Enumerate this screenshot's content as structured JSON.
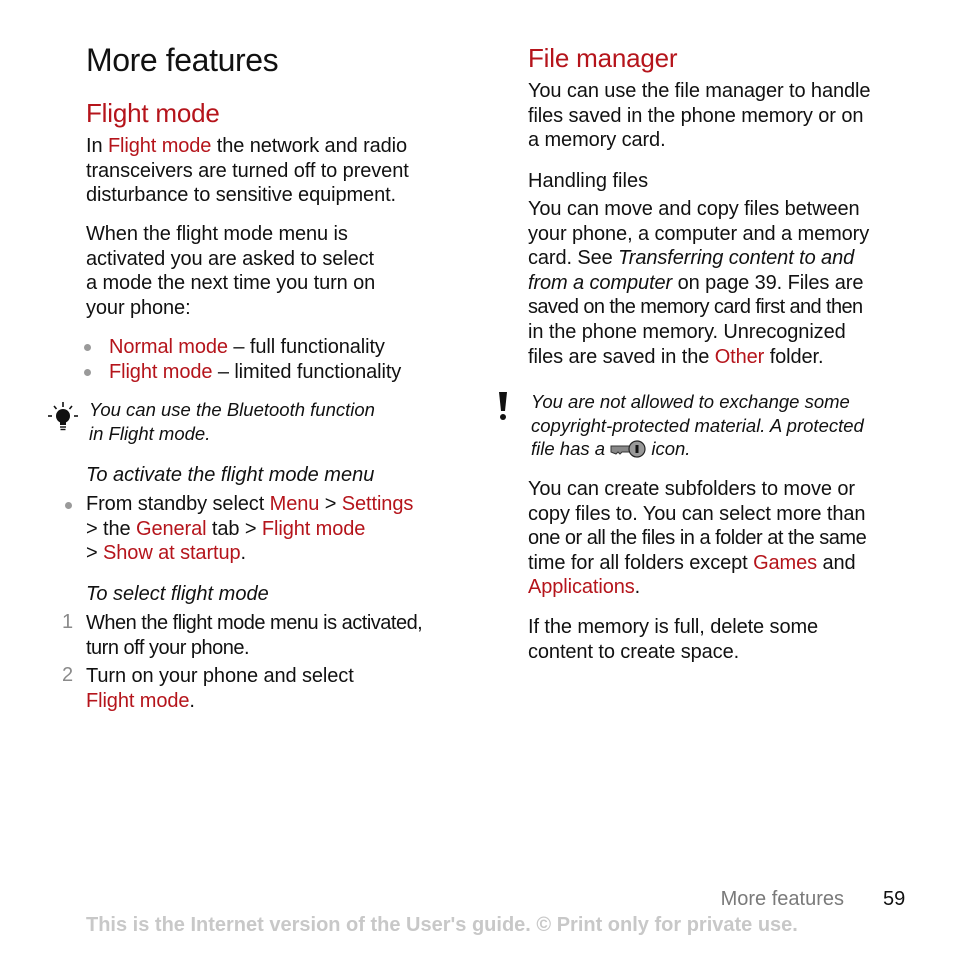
{
  "page": {
    "title": "More features",
    "left": {
      "flight_mode": {
        "heading": "Flight mode",
        "intro": [
          "In ",
          "Flight mode",
          " the network and radio",
          "transceivers are turned off to prevent",
          "disturbance to sensitive equipment."
        ],
        "para2": [
          "When the flight mode menu is",
          "activated you are asked to select",
          "a mode the next time you turn on",
          "your phone:"
        ],
        "bullets": [
          {
            "link": "Normal mode",
            "text": " – full functionality"
          },
          {
            "link": "Flight mode",
            "text": " – limited functionality"
          }
        ],
        "tip": {
          "icon": "lightbulb-icon",
          "lines": [
            "You can use the Bluetooth function",
            "in Flight mode."
          ]
        },
        "activate": {
          "title": "To activate the flight mode menu",
          "step": {
            "parts": [
              "From standby select ",
              "Menu",
              " > ",
              "Settings"
            ],
            "line2": [
              "> the ",
              "General",
              " tab > ",
              "Flight mode"
            ],
            "line3": [
              "> ",
              "Show at startup",
              "."
            ]
          }
        },
        "select": {
          "title": "To select flight mode",
          "steps": [
            {
              "num": "1",
              "lines": [
                "When the flight mode menu is activated,",
                "turn off your phone."
              ]
            },
            {
              "num": "2",
              "line1": "Turn on your phone and select",
              "link": "Flight mode",
              "after": "."
            }
          ]
        }
      }
    },
    "right": {
      "file_manager": {
        "heading": "File manager",
        "intro": [
          "You can use the file manager to handle",
          "files saved in the phone memory or on",
          "a memory card."
        ],
        "handling": {
          "title": "Handling files",
          "lines": [
            "You can move and copy files between",
            "your phone, a computer and a memory",
            [
              "card. See ",
              "Transferring content to and"
            ],
            [
              "from a computer",
              " on page 39. Files are"
            ],
            "saved on the memory card first and then",
            "in the phone memory. Unrecognized",
            [
              "files are saved in the ",
              "Other",
              " folder."
            ]
          ]
        },
        "warning": {
          "icon": "exclamation-icon",
          "lines": [
            "You are not allowed to exchange some",
            "copyright-protected material. A protected"
          ],
          "line3_before": "file has a ",
          "inline_icon": "key-icon",
          "line3_after": " icon."
        },
        "subfolders": [
          "You can create subfolders to move or",
          "copy files to. You can select more than",
          "one or all the files in a folder at the same",
          [
            "time for all folders except ",
            "Games",
            " and"
          ],
          [
            "Applications",
            "."
          ]
        ],
        "memory_full": [
          "If the memory is full, delete some",
          "content to create space."
        ]
      }
    },
    "footer": {
      "section": "More features",
      "page_number": "59",
      "disclaimer": "This is the Internet version of the User's guide. © Print only for private use."
    },
    "colors": {
      "accent": "#b5141b",
      "text": "#111111",
      "muted": "#7a7a7a",
      "disclaimer": "#c8c8c8"
    }
  }
}
